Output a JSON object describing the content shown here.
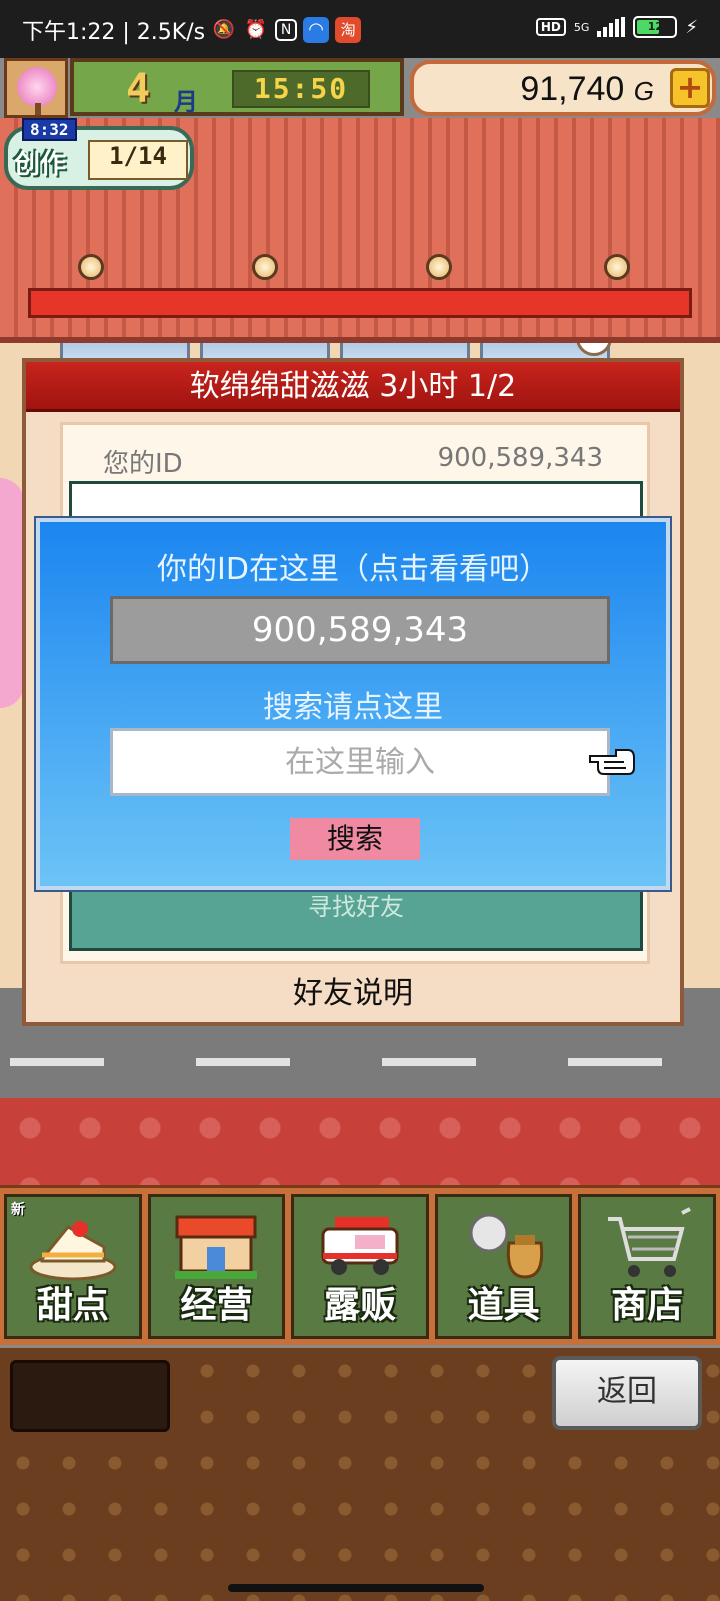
{
  "status_bar": {
    "time_text": "下午1:22 | 2.5K/s",
    "icons": [
      "mute-bell-icon",
      "alarm-icon",
      "nfc-icon",
      "app-icon",
      "taobao-icon"
    ],
    "taobao_glyph": "淘",
    "hd_label": "HD",
    "network_label": "5G",
    "battery_level": "12"
  },
  "hud": {
    "month_number": "4",
    "month_label": "月",
    "time": "15:50",
    "money": "91,740",
    "money_unit": "G",
    "add_money_label": "+",
    "create_timer": "8:32",
    "create_label": "创作",
    "create_progress": "1/14"
  },
  "panel": {
    "title": "软绵绵甜滋滋 3小时 1/2",
    "id_label": "您的ID",
    "id_value": "900,589,343",
    "find_friend": "寻找好友",
    "friend_help": "好友说明"
  },
  "dialog": {
    "title": "你的ID在这里（点击看看吧）",
    "id_value": "900,589,343",
    "search_hint": "搜索请点这里",
    "input_placeholder": "在这里输入",
    "input_value": "",
    "search_button": "搜索"
  },
  "menu": {
    "new_badge": "新",
    "items": [
      {
        "label": "甜点",
        "icon": "cake-icon"
      },
      {
        "label": "经营",
        "icon": "shop-icon"
      },
      {
        "label": "露贩",
        "icon": "food-truck-icon"
      },
      {
        "label": "道具",
        "icon": "items-bag-icon"
      },
      {
        "label": "商店",
        "icon": "shopping-cart-icon"
      }
    ]
  },
  "footer": {
    "back_button": "返回"
  },
  "colors": {
    "dialog_top": "#1c86f0",
    "dialog_bottom": "#6cc4f6",
    "panel_header": "#c8241c",
    "search_button": "#f08aa2",
    "menu_button": "#5a7a44"
  }
}
